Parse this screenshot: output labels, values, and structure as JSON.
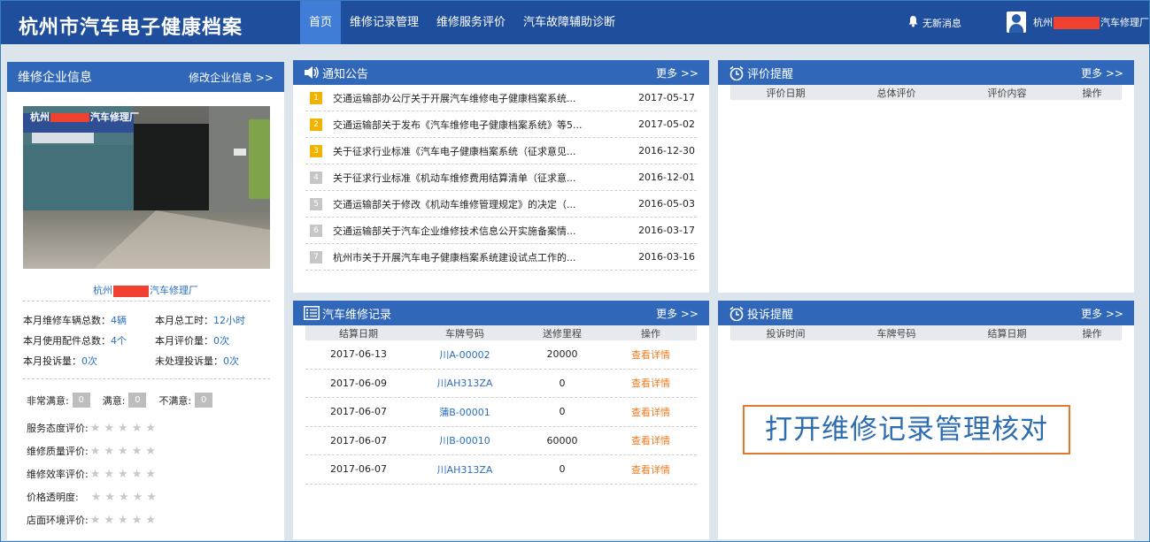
{
  "app": {
    "title": "杭州市汽车电子健康档案"
  },
  "nav": [
    {
      "label": "首页",
      "active": true
    },
    {
      "label": "维修记录管理",
      "active": false
    },
    {
      "label": "维修服务评价",
      "active": false
    },
    {
      "label": "汽车故障辅助诊断",
      "active": false
    }
  ],
  "header": {
    "messages": "无新消息",
    "user_prefix": "杭州",
    "user_suffix": "汽车修理厂"
  },
  "company": {
    "title": "维修企业信息",
    "edit_link": "修改企业信息 >>",
    "sign_text": "杭州",
    "sign_suffix": "汽车修理厂",
    "name_prefix": "杭州",
    "name_suffix": "汽车修理厂",
    "stats": [
      {
        "label": "本月维修车辆总数：",
        "value": "4辆"
      },
      {
        "label": "本月总工时：",
        "value": "12小时"
      },
      {
        "label": "本月使用配件总数：",
        "value": "4个"
      },
      {
        "label": "本月评价量：",
        "value": "0次"
      },
      {
        "label": "本月投诉量：",
        "value": "0次"
      },
      {
        "label": "未处理投诉量：",
        "value": "0次"
      }
    ],
    "satisfaction": [
      {
        "label": "非常满意:",
        "value": "0"
      },
      {
        "label": "满意:",
        "value": "0"
      },
      {
        "label": "不满意:",
        "value": "0"
      }
    ],
    "ratings": [
      {
        "label": "服务态度评价:",
        "stars": 0
      },
      {
        "label": "维修质量评价:",
        "stars": 0
      },
      {
        "label": "维修效率评价:",
        "stars": 0
      },
      {
        "label": "价格透明度:",
        "stars": 0
      },
      {
        "label": "店面环境评价:",
        "stars": 0
      }
    ]
  },
  "notice": {
    "title": "通知公告",
    "more": "更多 >>",
    "items": [
      {
        "num": "1",
        "text": "交通运输部办公厅关于开展汽车维修电子健康档案系统...",
        "date": "2017-05-17",
        "hot": true
      },
      {
        "num": "2",
        "text": "交通运输部关于发布《汽车维修电子健康档案系统》等5...",
        "date": "2017-05-02",
        "hot": true
      },
      {
        "num": "3",
        "text": "关于征求行业标准《汽车电子健康档案系统（征求意见...",
        "date": "2016-12-30",
        "hot": true
      },
      {
        "num": "4",
        "text": "关于征求行业标准《机动车维修费用结算清单（征求意...",
        "date": "2016-12-01",
        "hot": false
      },
      {
        "num": "5",
        "text": "交通运输部关于修改《机动车维修管理规定》的决定（...",
        "date": "2016-05-03",
        "hot": false
      },
      {
        "num": "6",
        "text": "交通运输部关于汽车企业维修技术信息公开实施备案情...",
        "date": "2016-03-17",
        "hot": false
      },
      {
        "num": "7",
        "text": "杭州市关于开展汽车电子健康档案系统建设试点工作的...",
        "date": "2016-03-16",
        "hot": false
      }
    ]
  },
  "review": {
    "title": "评价提醒",
    "more": "更多 >>",
    "columns": [
      "评价日期",
      "总体评价",
      "评价内容",
      "操作"
    ]
  },
  "repair": {
    "title": "汽车维修记录",
    "more": "更多 >>",
    "columns": [
      "结算日期",
      "车牌号码",
      "送修里程",
      "操作"
    ],
    "rows": [
      {
        "date": "2017-06-13",
        "plate": "川A-00002",
        "mileage": "20000",
        "action": "查看详情"
      },
      {
        "date": "2017-06-09",
        "plate": "川AH313ZA",
        "mileage": "0",
        "action": "查看详情"
      },
      {
        "date": "2017-06-07",
        "plate": "蒲B-00001",
        "mileage": "0",
        "action": "查看详情"
      },
      {
        "date": "2017-06-07",
        "plate": "川B-00010",
        "mileage": "60000",
        "action": "查看详情"
      },
      {
        "date": "2017-06-07",
        "plate": "川AH313ZA",
        "mileage": "0",
        "action": "查看详情"
      }
    ]
  },
  "complaint": {
    "title": "投诉提醒",
    "more": "更多 >>",
    "columns": [
      "投诉时间",
      "车牌号码",
      "结算日期",
      "操作"
    ]
  },
  "callout": {
    "text": "打开维修记录管理核对"
  }
}
